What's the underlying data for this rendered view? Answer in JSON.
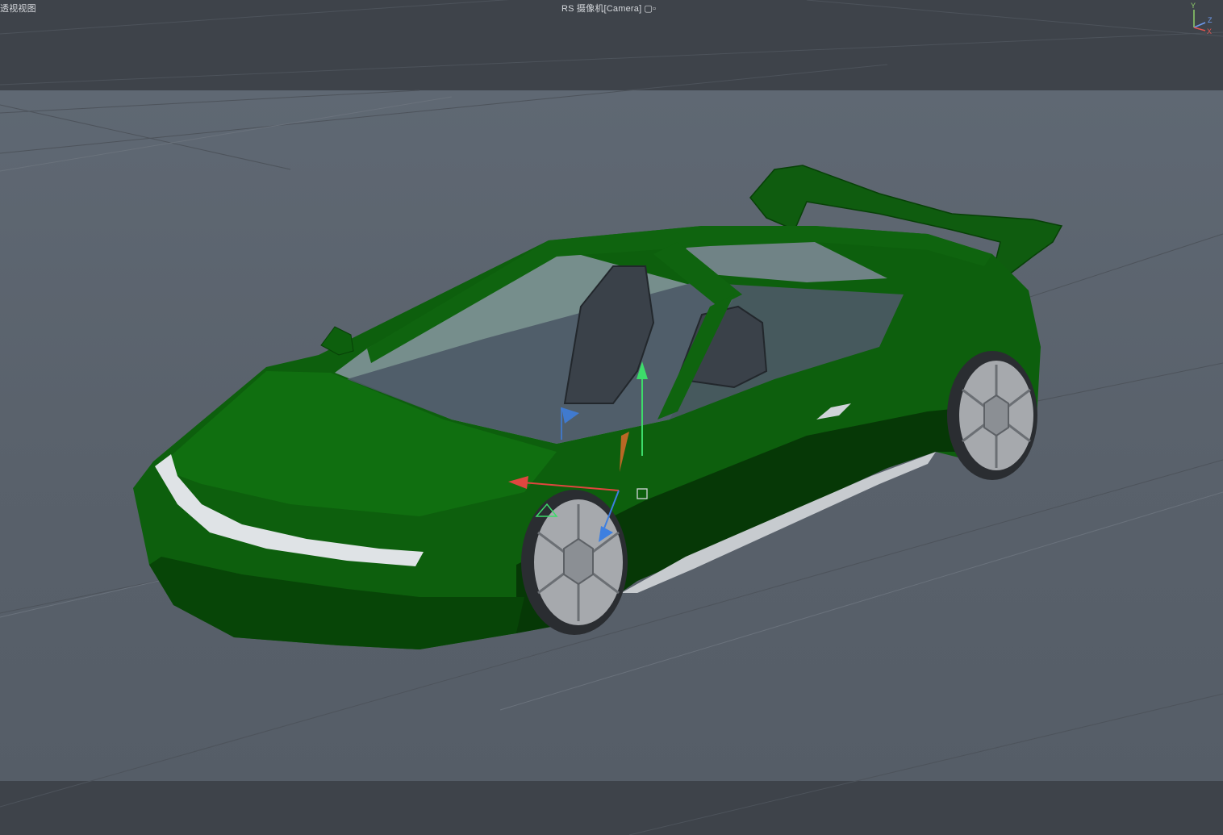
{
  "viewport": {
    "view_name": "透视视图",
    "camera_label": "RS 摄像机[Camera]",
    "camera_icon": "camera-link-icon",
    "axes": {
      "y": "Y",
      "z": "Z",
      "x": "X"
    }
  },
  "colors": {
    "background": "#3e434a",
    "render_region": "#5b636d",
    "car_body": "#0d5e0d",
    "car_body_dark": "#073d07",
    "headlight_strip": "#dfe3e6",
    "wheel_rim": "#a9acaf",
    "axis_y": "#3ddc6a",
    "axis_x": "#e0463f",
    "axis_z": "#3d7fe0"
  }
}
